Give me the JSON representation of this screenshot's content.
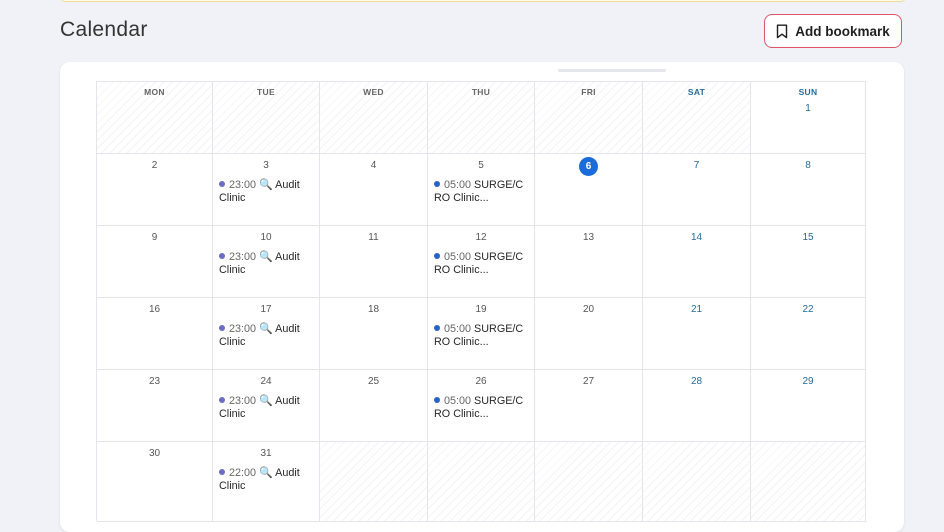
{
  "page": {
    "title": "Calendar"
  },
  "toolbar": {
    "add_bookmark_label": "Add bookmark"
  },
  "calendar": {
    "weekdays": [
      "MON",
      "TUE",
      "WED",
      "THU",
      "FRI",
      "SAT",
      "SUN"
    ],
    "today_label": "6",
    "colors": {
      "weekend": "#256b9c",
      "today": "#1a6cdb",
      "event_dot_purple": "#6b6cc4",
      "event_dot_blue": "#2563c6",
      "accent_border": "#e0546a"
    },
    "days": {
      "d1": "1",
      "d2": "2",
      "d3": "3",
      "d4": "4",
      "d5": "5",
      "d7": "7",
      "d8": "8",
      "d9": "9",
      "d10": "10",
      "d11": "11",
      "d12": "12",
      "d13": "13",
      "d14": "14",
      "d15": "15",
      "d16": "16",
      "d17": "17",
      "d18": "18",
      "d19": "19",
      "d20": "20",
      "d21": "21",
      "d22": "22",
      "d23": "23",
      "d24": "24",
      "d25": "25",
      "d26": "26",
      "d27": "27",
      "d28": "28",
      "d29": "29",
      "d30": "30",
      "d31": "31"
    },
    "events": {
      "e3": {
        "time": "23:00",
        "icon": "magnifier-icon",
        "title_line1": "Audit",
        "title_line2": "Clinic"
      },
      "e5": {
        "time": "05:00",
        "title_line1": "SURGE/C",
        "title_line2": "RO Clinic..."
      },
      "e10": {
        "time": "23:00",
        "icon": "magnifier-icon",
        "title_line1": "Audit",
        "title_line2": "Clinic"
      },
      "e12": {
        "time": "05:00",
        "title_line1": "SURGE/C",
        "title_line2": "RO Clinic..."
      },
      "e17": {
        "time": "23:00",
        "icon": "magnifier-icon",
        "title_line1": "Audit",
        "title_line2": "Clinic"
      },
      "e19": {
        "time": "05:00",
        "title_line1": "SURGE/C",
        "title_line2": "RO Clinic..."
      },
      "e24": {
        "time": "23:00",
        "icon": "magnifier-icon",
        "title_line1": "Audit",
        "title_line2": "Clinic"
      },
      "e26": {
        "time": "05:00",
        "title_line1": "SURGE/C",
        "title_line2": "RO Clinic..."
      },
      "e31": {
        "time": "22:00",
        "icon": "magnifier-icon",
        "title_line1": "Audit",
        "title_line2": "Clinic"
      }
    }
  }
}
